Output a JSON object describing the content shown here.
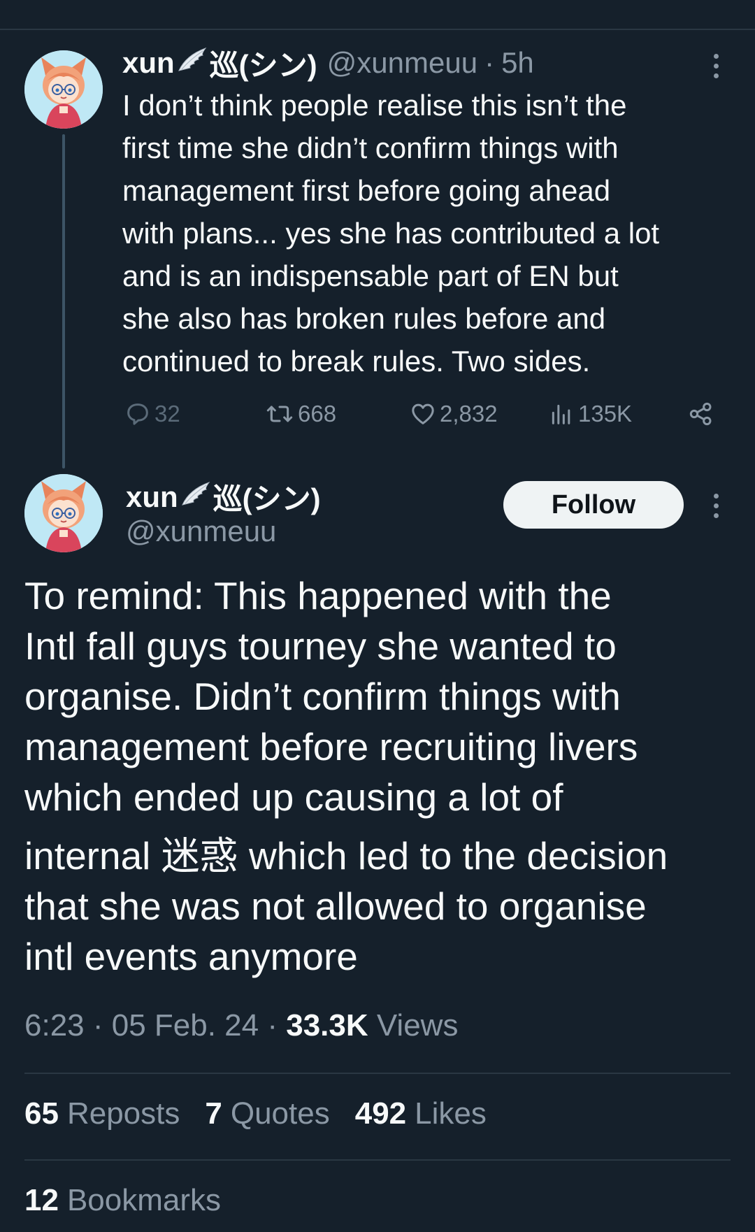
{
  "parent_tweet": {
    "display_name": "xun",
    "display_name_suffix": "巡(シン)",
    "handle": "@xunmeuu",
    "separator": "·",
    "time_ago": "5h",
    "text": "I don’t think people realise this isn’t the\nfirst time she didn’t confirm things with\nmanagement first before going ahead\nwith plans... yes she has contributed a lot\nand is an indispensable part of EN but\nshe also has broken rules before and\ncontinued to break rules. Two sides.",
    "actions": {
      "replies": "32",
      "reposts": "668",
      "likes": "2,832",
      "views": "135K"
    },
    "icons": [
      "reply-icon",
      "repost-icon",
      "like-icon",
      "views-icon",
      "share-icon",
      "more-icon"
    ]
  },
  "main_tweet": {
    "display_name": "xun",
    "display_name_suffix": "巡(シン)",
    "handle": "@xunmeuu",
    "follow_label": "Follow",
    "text_lines": [
      "To remind: This happened with the",
      "Intl fall guys tourney she wanted to",
      "organise. Didn’t confirm things with",
      "management before recruiting livers",
      "which ended up causing a lot of",
      "internal 迷惑 which led to the decision",
      "that she was not allowed to organise",
      "intl events anymore"
    ],
    "timestamp": "6:23 · 05 Feb. 24 · ",
    "views_count": "33.3K",
    "views_label": "Views",
    "stats": {
      "reposts_count": "65",
      "reposts_label": "Reposts",
      "quotes_count": "7",
      "quotes_label": "Quotes",
      "likes_count": "492",
      "likes_label": "Likes",
      "bookmarks_count": "12",
      "bookmarks_label": "Bookmarks"
    }
  },
  "colors": {
    "background": "#15202b",
    "text_primary": "#f7f9f9",
    "text_secondary": "#8b98a5",
    "divider": "#2a3743",
    "follow_bg": "#eff3f4",
    "thread_line": "#3d5466"
  }
}
